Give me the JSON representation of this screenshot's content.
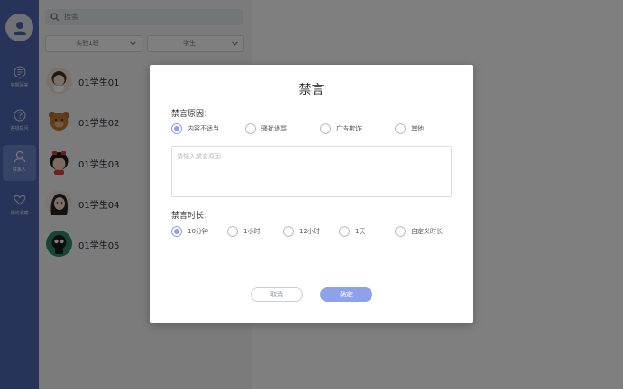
{
  "sidebar": {
    "items": [
      {
        "label": "掌握回答",
        "icon": "feedback-icon"
      },
      {
        "label": "答疑提问",
        "icon": "question-icon"
      },
      {
        "label": "联系人",
        "icon": "contacts-icon"
      },
      {
        "label": "我的收藏",
        "icon": "heart-icon"
      }
    ]
  },
  "panel": {
    "search_placeholder": "搜索",
    "filter_class": "实验1班",
    "filter_role": "学生",
    "students": [
      {
        "name": "01学生01"
      },
      {
        "name": "01学生02"
      },
      {
        "name": "01学生03"
      },
      {
        "name": "01学生04"
      },
      {
        "name": "01学生05"
      }
    ]
  },
  "modal": {
    "title": "禁言",
    "reason_label": "禁言原因：",
    "reasons": [
      "内容不适当",
      "骚扰谩骂",
      "广告欺诈",
      "其他"
    ],
    "reason_placeholder": "请输入禁言原因",
    "duration_label": "禁言时长：",
    "durations": [
      "10分钟",
      "1小时",
      "12小时",
      "1天",
      "自定义时长"
    ],
    "cancel_label": "取消",
    "confirm_label": "确定"
  },
  "colors": {
    "nav_bg": "#4f67b0",
    "accent": "#8ea2ea",
    "overlay": "rgba(0,0,0,0.5)"
  }
}
